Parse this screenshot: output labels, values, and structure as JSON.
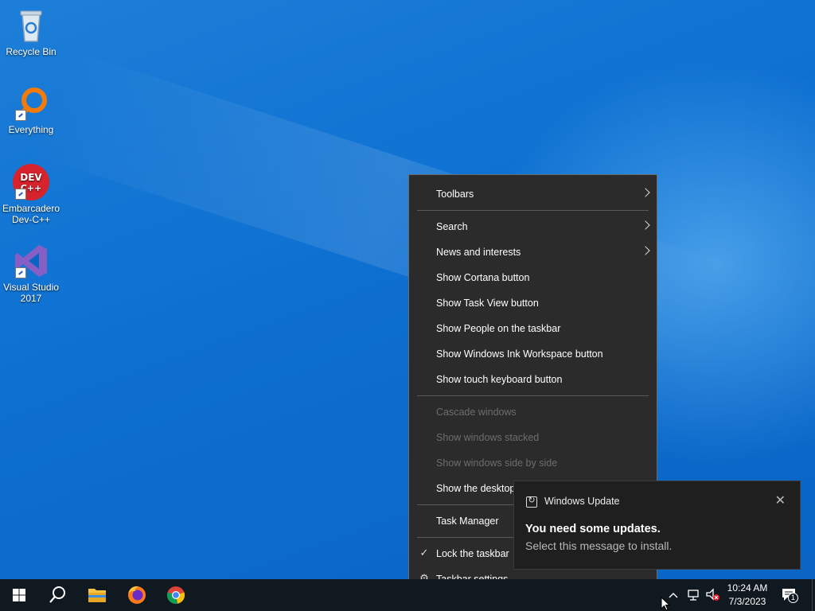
{
  "desktop": {
    "icons": [
      {
        "label": "Recycle Bin"
      },
      {
        "label": "Everything"
      },
      {
        "label": "Embarcadero Dev-C++",
        "badge": "DEV C++"
      },
      {
        "label": "Visual Studio 2017"
      }
    ]
  },
  "context_menu": {
    "items": [
      {
        "label": "Toolbars",
        "submenu": true,
        "enabled": true
      },
      {
        "label": "Search",
        "submenu": true,
        "enabled": true
      },
      {
        "label": "News and interests",
        "submenu": true,
        "enabled": true
      },
      {
        "label": "Show Cortana button",
        "enabled": true
      },
      {
        "label": "Show Task View button",
        "enabled": true
      },
      {
        "label": "Show People on the taskbar",
        "enabled": true
      },
      {
        "label": "Show Windows Ink Workspace button",
        "enabled": true
      },
      {
        "label": "Show touch keyboard button",
        "enabled": true
      },
      {
        "label": "Cascade windows",
        "enabled": false
      },
      {
        "label": "Show windows stacked",
        "enabled": false
      },
      {
        "label": "Show windows side by side",
        "enabled": false
      },
      {
        "label": "Show the desktop",
        "enabled": true
      },
      {
        "label": "Task Manager",
        "enabled": true
      },
      {
        "label": "Lock the taskbar",
        "enabled": true,
        "checked": true,
        "icon": "checkmark-icon"
      },
      {
        "label": "Taskbar settings",
        "enabled": true,
        "icon": "gear-icon"
      }
    ]
  },
  "toast": {
    "app_name": "Windows Update",
    "headline": "You need some updates.",
    "body": "Select this message to install.",
    "close_glyph": "✕"
  },
  "taskbar": {
    "pinned": [
      "start-button",
      "search-button",
      "file-explorer",
      "firefox",
      "chrome"
    ],
    "clock_time": "10:24 AM",
    "clock_date": "7/3/2023",
    "notification_count": "1"
  },
  "colors": {
    "menu_bg": "#2b2b2b",
    "menu_disabled": "#6d6d6d",
    "taskbar_bg": "#101820",
    "desktop_accent": "#0a64c4"
  }
}
